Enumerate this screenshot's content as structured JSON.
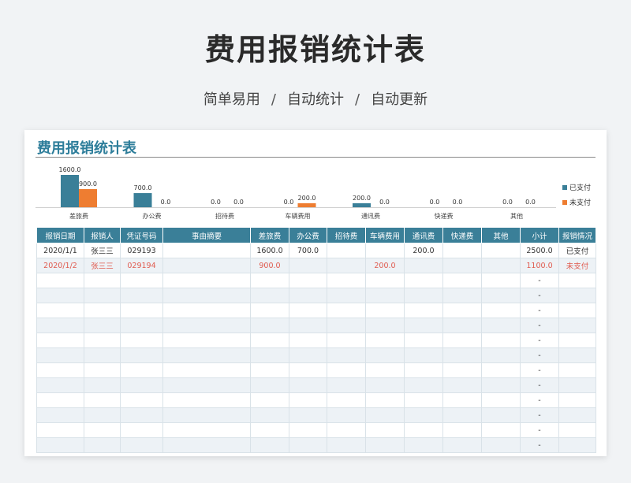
{
  "hero": {
    "title": "费用报销统计表",
    "subtitle_parts": [
      "简单易用",
      "/",
      "自动统计",
      "/",
      "自动更新"
    ]
  },
  "sheet": {
    "title": "费用报销统计表"
  },
  "colors": {
    "paid": "#3a7f98",
    "unpaid": "#ee7d31",
    "header_bg": "#3a7f98",
    "unpaid_text": "#e05a4e"
  },
  "chart_data": {
    "type": "bar",
    "categories": [
      "差旅费",
      "办公费",
      "招待费",
      "车辆费用",
      "通讯费",
      "快递费",
      "其他"
    ],
    "series": [
      {
        "name": "已支付",
        "values": [
          1600.0,
          700.0,
          0.0,
          0.0,
          200.0,
          0.0,
          0.0
        ]
      },
      {
        "name": "未支付",
        "values": [
          900.0,
          0.0,
          0.0,
          200.0,
          0.0,
          0.0,
          0.0
        ]
      }
    ],
    "data_labels": [
      [
        "1600.0",
        "700.0",
        "0.0",
        "0.0",
        "200.0",
        "0.0",
        "0.0"
      ],
      [
        "900.0",
        "0.0",
        "0.0",
        "200.0",
        "0.0",
        "0.0",
        "0.0"
      ]
    ],
    "ylim": [
      0,
      1600
    ],
    "legend": "right",
    "grid": false
  },
  "table": {
    "headers": [
      "报销日期",
      "报销人",
      "凭证号码",
      "事由摘要",
      "差旅费",
      "办公费",
      "招待费",
      "车辆费用",
      "通讯费",
      "快递费",
      "其他",
      "小计",
      "报销情况"
    ],
    "rows": [
      [
        "2020/1/1",
        "张三三",
        "029193",
        "",
        "1600.0",
        "700.0",
        "",
        "",
        "200.0",
        "",
        "",
        "2500.0",
        "已支付"
      ],
      [
        "2020/1/2",
        "张三三",
        "029194",
        "",
        "900.0",
        "",
        "",
        "200.0",
        "",
        "",
        "",
        "1100.0",
        "未支付"
      ],
      [
        "",
        "",
        "",
        "",
        "",
        "",
        "",
        "",
        "",
        "",
        "",
        "-",
        ""
      ],
      [
        "",
        "",
        "",
        "",
        "",
        "",
        "",
        "",
        "",
        "",
        "",
        "-",
        ""
      ],
      [
        "",
        "",
        "",
        "",
        "",
        "",
        "",
        "",
        "",
        "",
        "",
        "-",
        ""
      ],
      [
        "",
        "",
        "",
        "",
        "",
        "",
        "",
        "",
        "",
        "",
        "",
        "-",
        ""
      ],
      [
        "",
        "",
        "",
        "",
        "",
        "",
        "",
        "",
        "",
        "",
        "",
        "-",
        ""
      ],
      [
        "",
        "",
        "",
        "",
        "",
        "",
        "",
        "",
        "",
        "",
        "",
        "-",
        ""
      ],
      [
        "",
        "",
        "",
        "",
        "",
        "",
        "",
        "",
        "",
        "",
        "",
        "-",
        ""
      ],
      [
        "",
        "",
        "",
        "",
        "",
        "",
        "",
        "",
        "",
        "",
        "",
        "-",
        ""
      ],
      [
        "",
        "",
        "",
        "",
        "",
        "",
        "",
        "",
        "",
        "",
        "",
        "-",
        ""
      ],
      [
        "",
        "",
        "",
        "",
        "",
        "",
        "",
        "",
        "",
        "",
        "",
        "-",
        ""
      ],
      [
        "",
        "",
        "",
        "",
        "",
        "",
        "",
        "",
        "",
        "",
        "",
        "-",
        ""
      ],
      [
        "",
        "",
        "",
        "",
        "",
        "",
        "",
        "",
        "",
        "",
        "",
        "-",
        ""
      ]
    ]
  }
}
